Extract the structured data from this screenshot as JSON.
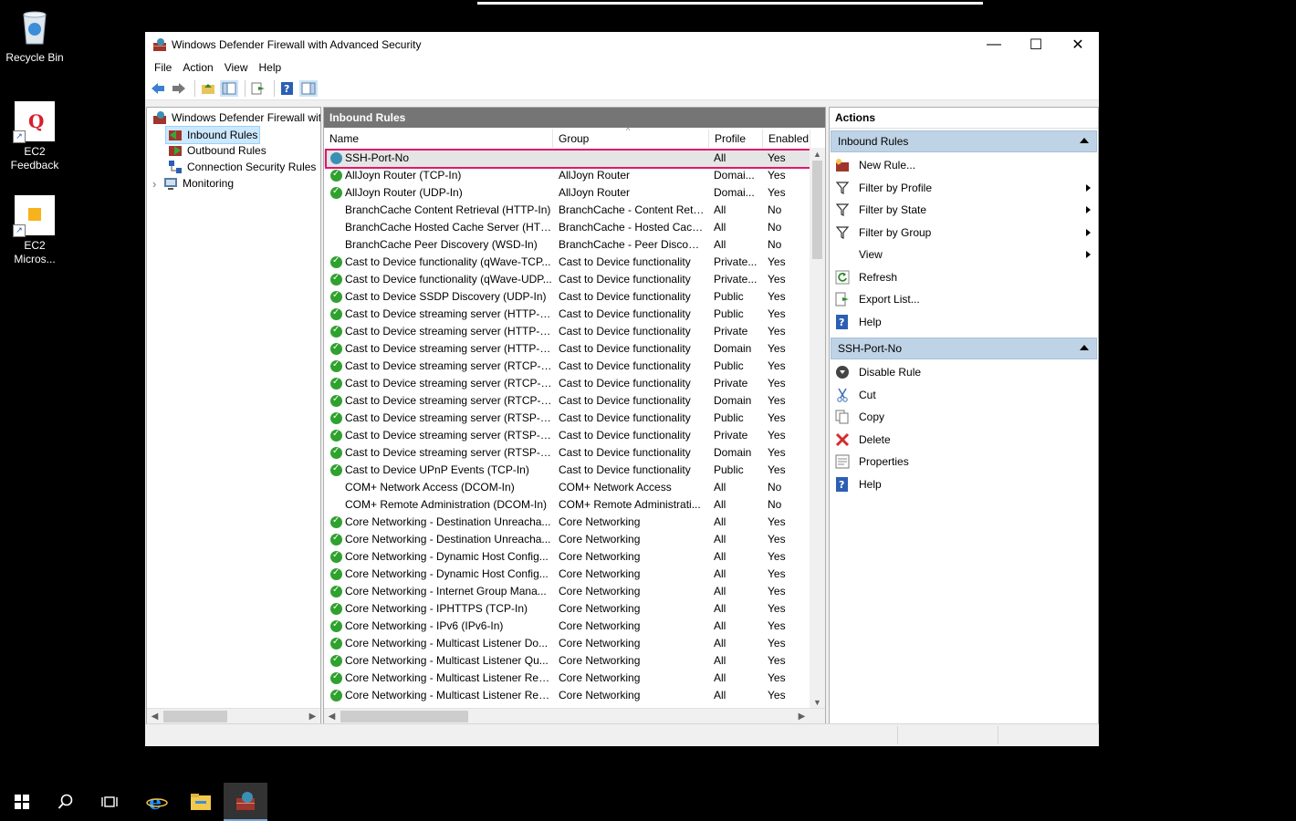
{
  "desktop": {
    "icons": [
      {
        "label": "Recycle Bin"
      },
      {
        "label": "EC2 Feedback"
      },
      {
        "label": "EC2 Micros..."
      }
    ]
  },
  "window": {
    "title": "Windows Defender Firewall with Advanced Security",
    "controls": {
      "minimize": "—",
      "maximize": "☐",
      "close": "✕"
    }
  },
  "menu": [
    "File",
    "Action",
    "View",
    "Help"
  ],
  "tree": {
    "root": "Windows Defender Firewall with Advanced Security on Local Computer",
    "items": [
      "Inbound Rules",
      "Outbound Rules",
      "Connection Security Rules",
      "Monitoring"
    ],
    "expander": "›"
  },
  "center": {
    "title": "Inbound Rules",
    "columns": {
      "name": "Name",
      "group": "Group",
      "profile": "Profile",
      "enabled": "Enabled"
    },
    "rows": [
      {
        "name": "SSH-Port-No",
        "group": "",
        "profile": "All",
        "enabled": "Yes",
        "icon": "globe"
      },
      {
        "name": "AllJoyn Router (TCP-In)",
        "group": "AllJoyn Router",
        "profile": "Domai...",
        "enabled": "Yes",
        "icon": "ok"
      },
      {
        "name": "AllJoyn Router (UDP-In)",
        "group": "AllJoyn Router",
        "profile": "Domai...",
        "enabled": "Yes",
        "icon": "ok"
      },
      {
        "name": "BranchCache Content Retrieval (HTTP-In)",
        "group": "BranchCache - Content Retr...",
        "profile": "All",
        "enabled": "No",
        "icon": "none"
      },
      {
        "name": "BranchCache Hosted Cache Server (HTT...",
        "group": "BranchCache - Hosted Cach...",
        "profile": "All",
        "enabled": "No",
        "icon": "none"
      },
      {
        "name": "BranchCache Peer Discovery (WSD-In)",
        "group": "BranchCache - Peer Discove...",
        "profile": "All",
        "enabled": "No",
        "icon": "none"
      },
      {
        "name": "Cast to Device functionality (qWave-TCP...",
        "group": "Cast to Device functionality",
        "profile": "Private...",
        "enabled": "Yes",
        "icon": "ok"
      },
      {
        "name": "Cast to Device functionality (qWave-UDP...",
        "group": "Cast to Device functionality",
        "profile": "Private...",
        "enabled": "Yes",
        "icon": "ok"
      },
      {
        "name": "Cast to Device SSDP Discovery (UDP-In)",
        "group": "Cast to Device functionality",
        "profile": "Public",
        "enabled": "Yes",
        "icon": "ok"
      },
      {
        "name": "Cast to Device streaming server (HTTP-St...",
        "group": "Cast to Device functionality",
        "profile": "Public",
        "enabled": "Yes",
        "icon": "ok"
      },
      {
        "name": "Cast to Device streaming server (HTTP-St...",
        "group": "Cast to Device functionality",
        "profile": "Private",
        "enabled": "Yes",
        "icon": "ok"
      },
      {
        "name": "Cast to Device streaming server (HTTP-St...",
        "group": "Cast to Device functionality",
        "profile": "Domain",
        "enabled": "Yes",
        "icon": "ok"
      },
      {
        "name": "Cast to Device streaming server (RTCP-St...",
        "group": "Cast to Device functionality",
        "profile": "Public",
        "enabled": "Yes",
        "icon": "ok"
      },
      {
        "name": "Cast to Device streaming server (RTCP-St...",
        "group": "Cast to Device functionality",
        "profile": "Private",
        "enabled": "Yes",
        "icon": "ok"
      },
      {
        "name": "Cast to Device streaming server (RTCP-St...",
        "group": "Cast to Device functionality",
        "profile": "Domain",
        "enabled": "Yes",
        "icon": "ok"
      },
      {
        "name": "Cast to Device streaming server (RTSP-Str...",
        "group": "Cast to Device functionality",
        "profile": "Public",
        "enabled": "Yes",
        "icon": "ok"
      },
      {
        "name": "Cast to Device streaming server (RTSP-Str...",
        "group": "Cast to Device functionality",
        "profile": "Private",
        "enabled": "Yes",
        "icon": "ok"
      },
      {
        "name": "Cast to Device streaming server (RTSP-Str...",
        "group": "Cast to Device functionality",
        "profile": "Domain",
        "enabled": "Yes",
        "icon": "ok"
      },
      {
        "name": "Cast to Device UPnP Events (TCP-In)",
        "group": "Cast to Device functionality",
        "profile": "Public",
        "enabled": "Yes",
        "icon": "ok"
      },
      {
        "name": "COM+ Network Access (DCOM-In)",
        "group": "COM+ Network Access",
        "profile": "All",
        "enabled": "No",
        "icon": "none"
      },
      {
        "name": "COM+ Remote Administration (DCOM-In)",
        "group": "COM+ Remote Administrati...",
        "profile": "All",
        "enabled": "No",
        "icon": "none"
      },
      {
        "name": "Core Networking - Destination Unreacha...",
        "group": "Core Networking",
        "profile": "All",
        "enabled": "Yes",
        "icon": "ok"
      },
      {
        "name": "Core Networking - Destination Unreacha...",
        "group": "Core Networking",
        "profile": "All",
        "enabled": "Yes",
        "icon": "ok"
      },
      {
        "name": "Core Networking - Dynamic Host Config...",
        "group": "Core Networking",
        "profile": "All",
        "enabled": "Yes",
        "icon": "ok"
      },
      {
        "name": "Core Networking - Dynamic Host Config...",
        "group": "Core Networking",
        "profile": "All",
        "enabled": "Yes",
        "icon": "ok"
      },
      {
        "name": "Core Networking - Internet Group Mana...",
        "group": "Core Networking",
        "profile": "All",
        "enabled": "Yes",
        "icon": "ok"
      },
      {
        "name": "Core Networking - IPHTTPS (TCP-In)",
        "group": "Core Networking",
        "profile": "All",
        "enabled": "Yes",
        "icon": "ok"
      },
      {
        "name": "Core Networking - IPv6 (IPv6-In)",
        "group": "Core Networking",
        "profile": "All",
        "enabled": "Yes",
        "icon": "ok"
      },
      {
        "name": "Core Networking - Multicast Listener Do...",
        "group": "Core Networking",
        "profile": "All",
        "enabled": "Yes",
        "icon": "ok"
      },
      {
        "name": "Core Networking - Multicast Listener Qu...",
        "group": "Core Networking",
        "profile": "All",
        "enabled": "Yes",
        "icon": "ok"
      },
      {
        "name": "Core Networking - Multicast Listener Rep...",
        "group": "Core Networking",
        "profile": "All",
        "enabled": "Yes",
        "icon": "ok"
      },
      {
        "name": "Core Networking - Multicast Listener Rep...",
        "group": "Core Networking",
        "profile": "All",
        "enabled": "Yes",
        "icon": "ok"
      }
    ]
  },
  "actions": {
    "title": "Actions",
    "sections": [
      {
        "title": "Inbound Rules",
        "items": [
          {
            "label": "New Rule...",
            "icon": "new-rule-icon",
            "submenu": false
          },
          {
            "label": "Filter by Profile",
            "icon": "filter-icon",
            "submenu": true
          },
          {
            "label": "Filter by State",
            "icon": "filter-icon",
            "submenu": true
          },
          {
            "label": "Filter by Group",
            "icon": "filter-icon",
            "submenu": true
          },
          {
            "label": "View",
            "icon": "none",
            "submenu": true
          },
          {
            "label": "Refresh",
            "icon": "refresh-icon",
            "submenu": false
          },
          {
            "label": "Export List...",
            "icon": "export-icon",
            "submenu": false
          },
          {
            "label": "Help",
            "icon": "help-icon",
            "submenu": false
          }
        ]
      },
      {
        "title": "SSH-Port-No",
        "items": [
          {
            "label": "Disable Rule",
            "icon": "disable-icon",
            "submenu": false
          },
          {
            "label": "Cut",
            "icon": "cut-icon",
            "submenu": false
          },
          {
            "label": "Copy",
            "icon": "copy-icon",
            "submenu": false
          },
          {
            "label": "Delete",
            "icon": "delete-icon",
            "submenu": false
          },
          {
            "label": "Properties",
            "icon": "properties-icon",
            "submenu": false
          },
          {
            "label": "Help",
            "icon": "help-icon",
            "submenu": false
          }
        ]
      }
    ]
  },
  "taskbar": [
    "start-icon",
    "search-icon",
    "task-view-icon",
    "ie-icon",
    "file-explorer-icon",
    "firewall-app-icon"
  ]
}
